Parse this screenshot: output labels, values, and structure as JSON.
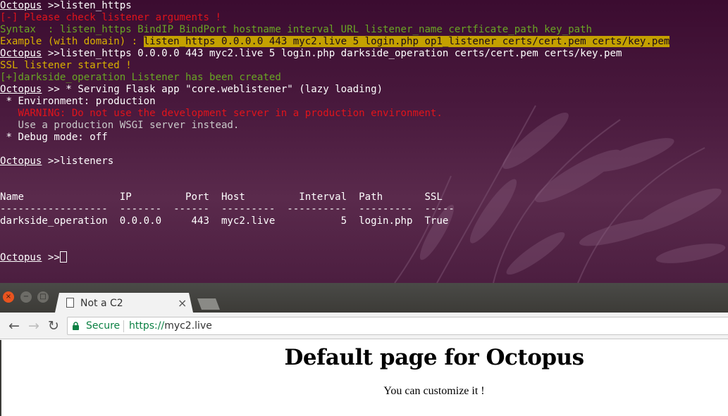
{
  "terminal": {
    "prompt": "Octopus",
    "prompt_sep": " >>",
    "lines": {
      "cmd1": "listen_https",
      "err": "[-] Please check listener arguments !",
      "syntax": "Syntax  : listen_https BindIP BindPort hostname interval URL listener_name certficate_path key_path",
      "example_label": "Example (with domain) : ",
      "example_cmd": "listen_https 0.0.0.0 443 myc2.live 5 login.php op1_listener certs/cert.pem certs/key.pem",
      "cmd2": "listen_https 0.0.0.0 443 myc2.live 5 login.php darkside_operation certs/cert.pem certs/key.pem",
      "ssl_started": "SSL listener started !",
      "created": "[+]darkside_operation Listener has been created",
      "flask": " * Serving Flask app \"core.weblistener\" (lazy loading)",
      "env": " * Environment: production",
      "warning": "   WARNING: Do not use the development server in a production environment.",
      "wsgi": "   Use a production WSGI server instead.",
      "debug": " * Debug mode: off",
      "cmd3": "listeners"
    },
    "table": {
      "header": "Name                IP         Port  Host         Interval  Path       SSL",
      "rule": "------------------  -------  ------  ---------  ----------  ---------  -----",
      "row": "darkside_operation  0.0.0.0     443  myc2.live           5  login.php  True"
    }
  },
  "browser": {
    "window_buttons": {
      "close": "×",
      "minimize": "−",
      "maximize": "□"
    },
    "tab_title": "Not a C2",
    "tab_close": "×",
    "nav": {
      "back": "←",
      "forward": "→",
      "reload": "↻"
    },
    "security_label": "Secure",
    "url_scheme": "https://",
    "url_host": "myc2.live",
    "page": {
      "heading": "Default page for Octopus",
      "text": "You can customize it !"
    }
  },
  "colors": {
    "terminal_bg": "#3b0c30",
    "error_red": "#e0141b",
    "success_green": "#69a524",
    "highlight_yellow": "#c4a000",
    "secure_green": "#0b8043"
  }
}
